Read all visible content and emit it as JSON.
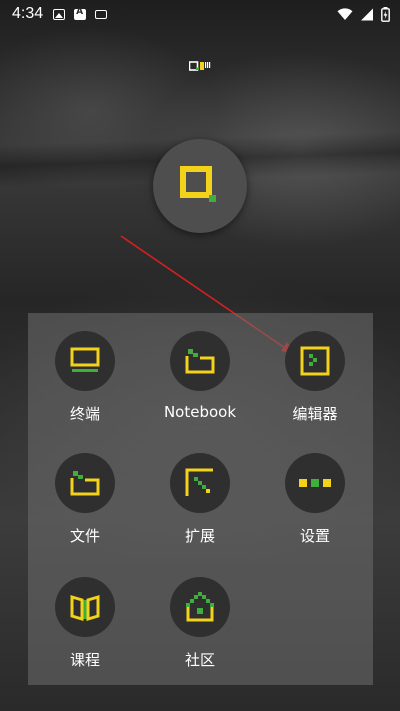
{
  "status_bar": {
    "time": "4:34",
    "left_icons": [
      "image-icon",
      "font-icon",
      "screen-icon"
    ],
    "right_icons": [
      "wifi-icon",
      "signal-icon",
      "battery-icon"
    ]
  },
  "colors": {
    "accent_yellow": "#f2d21b",
    "accent_green": "#3fae3a",
    "arrow_red": "#d32020"
  },
  "apps": [
    {
      "label": "终端",
      "icon": "terminal-icon"
    },
    {
      "label": "Notebook",
      "icon": "notebook-icon"
    },
    {
      "label": "编辑器",
      "icon": "editor-icon"
    },
    {
      "label": "文件",
      "icon": "folder-icon"
    },
    {
      "label": "扩展",
      "icon": "extension-icon"
    },
    {
      "label": "设置",
      "icon": "settings-icon"
    },
    {
      "label": "课程",
      "icon": "course-book-icon"
    },
    {
      "label": "社区",
      "icon": "community-icon"
    }
  ]
}
